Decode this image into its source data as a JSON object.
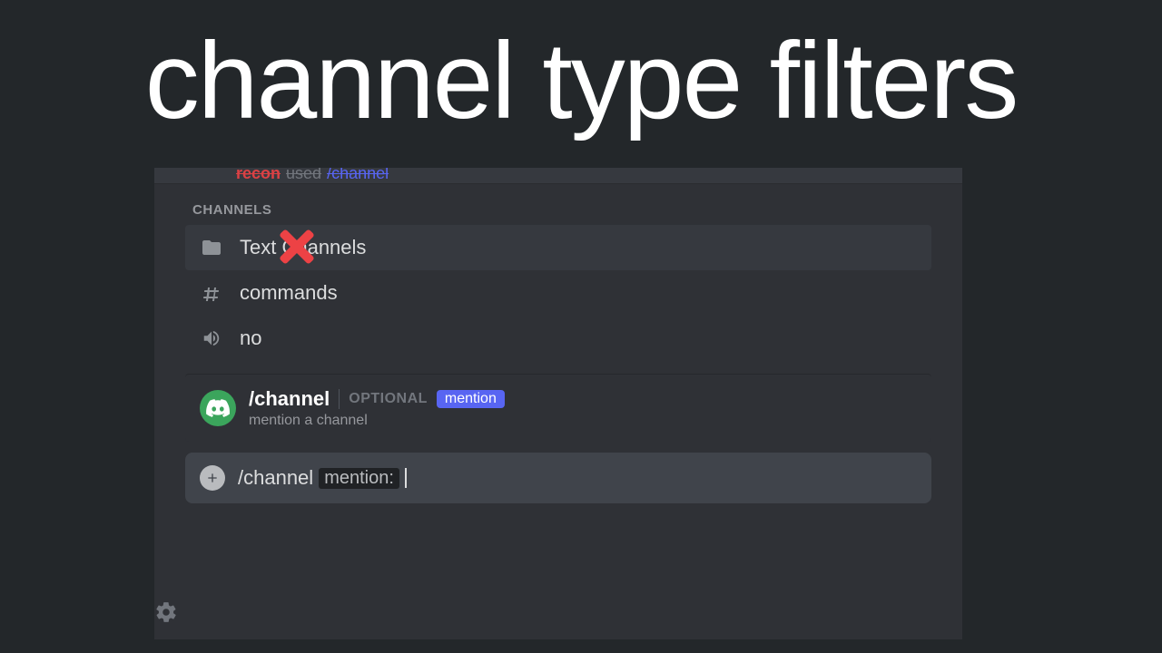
{
  "title": "channel type filters",
  "cropped_top": {
    "user": "recon",
    "used": "used",
    "slash": "/channel"
  },
  "popup": {
    "header": "CHANNELS",
    "items": [
      {
        "icon": "folder",
        "label": "Text Channels",
        "crossed": true
      },
      {
        "icon": "hash",
        "label": "commands"
      },
      {
        "icon": "volume",
        "label": "no"
      }
    ]
  },
  "command": {
    "name": "/channel",
    "optional_label": "OPTIONAL",
    "param_name": "mention",
    "description": "mention a channel"
  },
  "input": {
    "command": "/channel",
    "param_label": "mention:",
    "value": ""
  }
}
